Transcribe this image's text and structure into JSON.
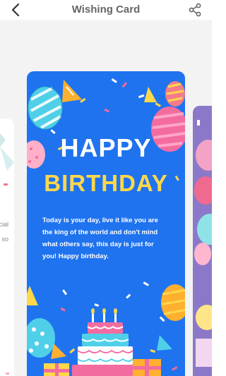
{
  "header": {
    "title": "Wishing Card",
    "back_icon": "chevron-left-icon",
    "share_icon": "share-icon"
  },
  "main_card": {
    "headline_top": "HAPPY",
    "headline_bottom": "BIRTHDAY",
    "message": "Today is your day, live it like you are the king of the world and don't mind what others say, this day is just for you! Happy birthday.",
    "colors": {
      "background": "#1f73ef",
      "headline_top": "#ffffff",
      "headline_bottom": "#ffd84a"
    }
  },
  "left_card": {
    "text_line1": "cial",
    "text_line2": ", so"
  },
  "right_card": {
    "background": "#8c78c8"
  }
}
